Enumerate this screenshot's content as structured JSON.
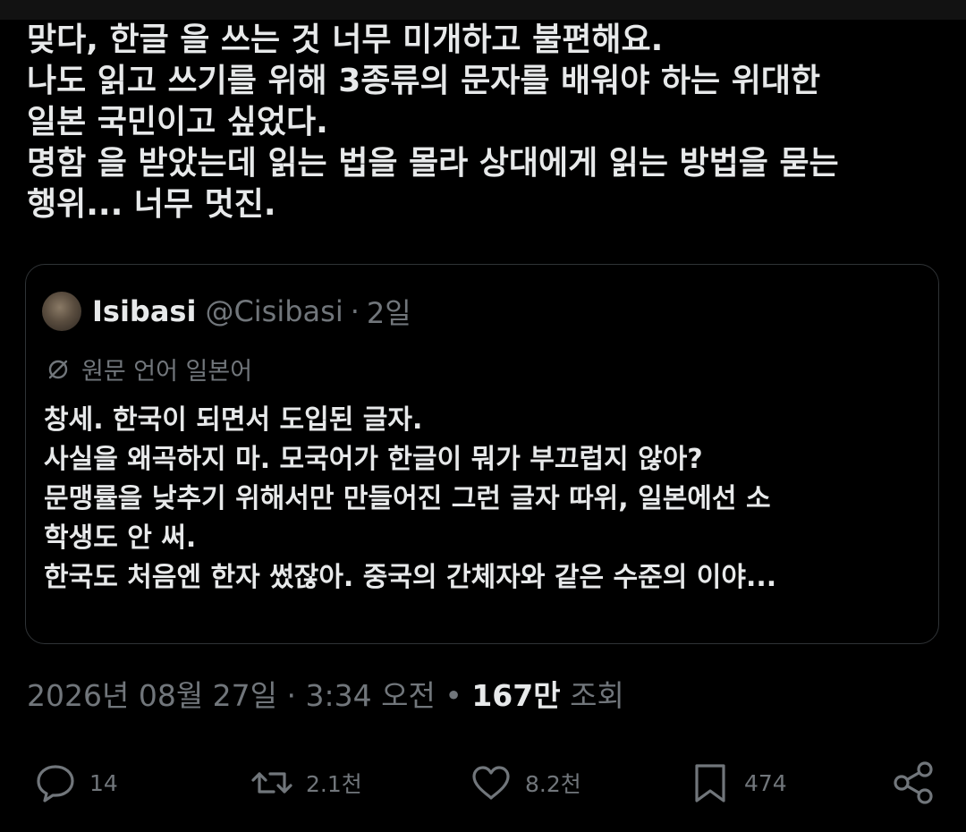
{
  "tweet": {
    "text": "맞다, 한글 을 쓰는 것 너무 미개하고 불편해요.\n나도 읽고 쓰기를 위해 3종류의 문자를 배워야 하는 위대한\n일본 국민이고 싶었다.\n명함 을 받았는데 읽는 법을 몰라 상대에게 읽는 방법을 묻는\n행위... 너무 멋진."
  },
  "quote": {
    "author_name": "Isibasi",
    "author_handle": "@Cisibasi",
    "separator": "·",
    "time": "2일",
    "translate_label": "원문 언어 일본어",
    "text": "창세. 한국이 되면서 도입된 글자.\n사실을 왜곡하지 마. 모국어가 한글이 뭐가 부끄럽지 않아?\n문맹률을 낮추기 위해서만 만들어진 그런 글자 따위, 일본에선 소\n학생도 안 써.\n한국도 처음엔 한자 썼잖아. 중국의 간체자와 같은 수준의 이야..."
  },
  "meta": {
    "date": "2026년 08월 27일",
    "sep1": "·",
    "time": "3:34 오전",
    "sep2": "•",
    "views_count": "167만",
    "views_label": "조회"
  },
  "actions": {
    "reply_count": "14",
    "retweet_count": "2.1천",
    "like_count": "8.2천",
    "bookmark_count": "474"
  },
  "icons": {
    "reply": "reply-icon",
    "retweet": "retweet-icon",
    "like": "heart-icon",
    "bookmark": "bookmark-icon",
    "share": "share-icon",
    "translate": "translate-icon"
  },
  "colors": {
    "background": "#000000",
    "text": "#e7e9ea",
    "secondary": "#71767b",
    "border": "#2f3336"
  }
}
